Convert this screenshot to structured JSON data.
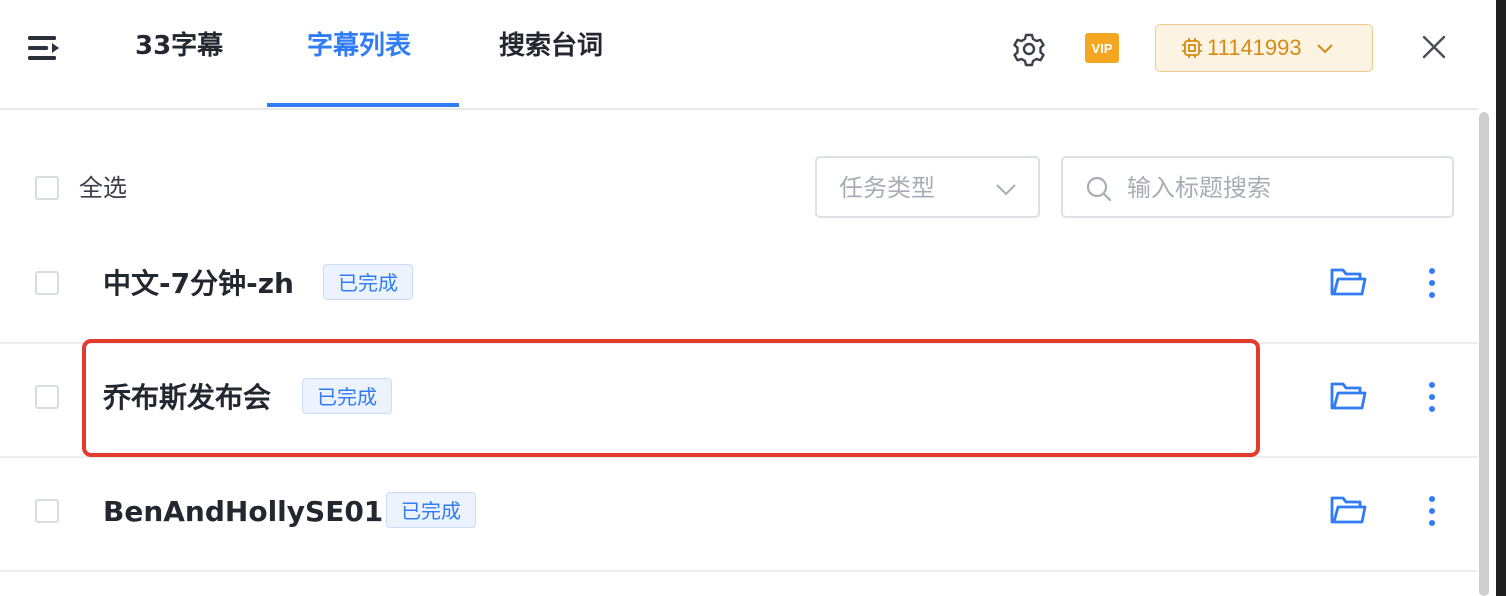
{
  "header": {
    "tabs": [
      {
        "label": "33字幕"
      },
      {
        "label": "字幕列表"
      },
      {
        "label": "搜索台词"
      }
    ],
    "active_tab": "字幕列表",
    "vip_label": "VIP",
    "credits": "11141993"
  },
  "toolbar": {
    "select_all_label": "全选",
    "task_type_placeholder": "任务类型",
    "search_placeholder": "输入标题搜索"
  },
  "rows": [
    {
      "title": "中文-7分钟-zh",
      "status": "已完成"
    },
    {
      "title": "乔布斯发布会",
      "status": "已完成"
    },
    {
      "title": "BenAndHollySE01",
      "status": "已完成"
    }
  ],
  "colors": {
    "accent": "#2f7cf6",
    "vip": "#f5a623",
    "credit_text": "#d58b16",
    "highlight_border": "#e33b2d"
  },
  "icons": [
    "menu-icon",
    "gear-icon",
    "cpu-chip-icon",
    "chevron-down-icon",
    "close-icon",
    "search-icon",
    "folder-open-icon",
    "more-vertical-icon"
  ]
}
